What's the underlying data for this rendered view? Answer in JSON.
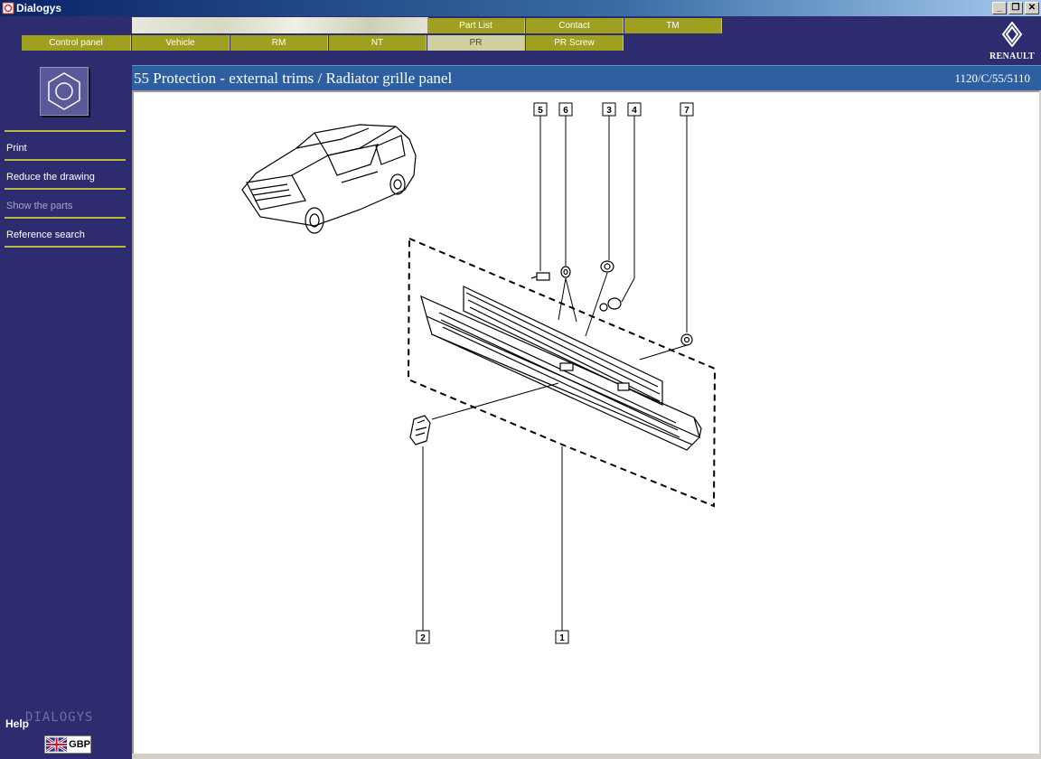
{
  "window": {
    "title": "Dialogys"
  },
  "nav": {
    "top_row": [
      "Part List",
      "Contact",
      "TM"
    ],
    "bottom_row": [
      "Control panel",
      "Vehicle",
      "RM",
      "NT",
      "PR",
      "PR Screw"
    ],
    "active": "PR"
  },
  "brand_logo": "RENAULT",
  "sidebar": {
    "icon": "hexagon-nut-icon",
    "menu": [
      {
        "label": "Print",
        "enabled": true
      },
      {
        "label": "Reduce the drawing",
        "enabled": true
      },
      {
        "label": "Show the parts",
        "enabled": false
      },
      {
        "label": "Reference search",
        "enabled": true
      }
    ],
    "help_label": "Help",
    "brand_label": "DIALOGYS",
    "currency": "GBP"
  },
  "header": {
    "title": "55 Protection - external trims / Radiator grille panel",
    "ref": "1120/C/55/5110"
  },
  "diagram": {
    "callouts": [
      "5",
      "6",
      "3",
      "4",
      "7",
      "2",
      "1"
    ]
  }
}
